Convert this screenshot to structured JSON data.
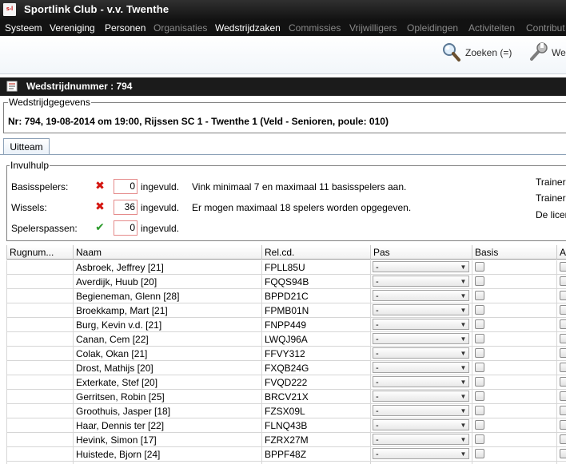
{
  "app": {
    "title": "Sportlink Club - v.v. Twenthe",
    "logo_text": "s-l"
  },
  "menu": [
    {
      "label": "Systeem",
      "enabled": true
    },
    {
      "label": "Vereniging",
      "enabled": true
    },
    {
      "label": "Personen",
      "enabled": true
    },
    {
      "label": "Organisaties",
      "enabled": false
    },
    {
      "label": "Wedstrijdzaken",
      "enabled": true
    },
    {
      "label": "Commissies",
      "enabled": false
    },
    {
      "label": "Vrijwilligers",
      "enabled": false
    },
    {
      "label": "Opleidingen",
      "enabled": false
    },
    {
      "label": "Activiteiten",
      "enabled": false
    },
    {
      "label": "Contribut",
      "enabled": false
    }
  ],
  "toolbar": {
    "search_label": "Zoeken (=)",
    "second_label": "We"
  },
  "document": {
    "title": "Wedstrijdnummer : 794"
  },
  "details": {
    "legend": "Wedstrijdgegevens",
    "match_info": "Nr: 794, 19-08-2014 om 19:00, Rijssen SC 1 - Twenthe 1 (Veld - Senioren, poule: 010)"
  },
  "tabs": [
    {
      "label": "Uitteam"
    }
  ],
  "invulhulp": {
    "legend": "Invulhulp",
    "rows": [
      {
        "label": "Basisspelers:",
        "status": "error",
        "status_icon": "✖",
        "count": "0",
        "suffix": "ingevuld.",
        "message": "Vink minimaal 7 en maximaal 11 basisspelers aan."
      },
      {
        "label": "Wissels:",
        "status": "error",
        "status_icon": "✖",
        "count": "36",
        "suffix": "ingevuld.",
        "message": "Er mogen maximaal 18 spelers worden opgegeven."
      },
      {
        "label": "Spelerspassen:",
        "status": "ok",
        "status_icon": "✔",
        "count": "0",
        "suffix": "ingevuld.",
        "message": ""
      }
    ],
    "right_texts": [
      "Trainer",
      "Trainer",
      "De licer"
    ]
  },
  "table": {
    "columns": [
      "Rugnum...",
      "Naam",
      "Rel.cd.",
      "Pas",
      "Basis",
      "A"
    ],
    "pas_default": "-",
    "rows": [
      {
        "rug": "",
        "naam": "Asbroek, Jeffrey  [21]",
        "rel": "FPLL85U"
      },
      {
        "rug": "",
        "naam": "Averdijk, Huub  [20]",
        "rel": "FQQS94B"
      },
      {
        "rug": "",
        "naam": "Begieneman, Glenn  [28]",
        "rel": "BPPD21C"
      },
      {
        "rug": "",
        "naam": "Broekkamp, Mart  [21]",
        "rel": "FPMB01N"
      },
      {
        "rug": "",
        "naam": "Burg, Kevin v.d.  [21]",
        "rel": "FNPP449"
      },
      {
        "rug": "",
        "naam": "Canan, Cem  [22]",
        "rel": "LWQJ96A"
      },
      {
        "rug": "",
        "naam": "Colak, Okan  [21]",
        "rel": "FFVY312"
      },
      {
        "rug": "",
        "naam": "Drost, Mathijs  [20]",
        "rel": "FXQB24G"
      },
      {
        "rug": "",
        "naam": "Exterkate, Stef  [20]",
        "rel": "FVQD222"
      },
      {
        "rug": "",
        "naam": "Gerritsen, Robin  [25]",
        "rel": "BRCV21X"
      },
      {
        "rug": "",
        "naam": "Groothuis, Jasper  [18]",
        "rel": "FZSX09L"
      },
      {
        "rug": "",
        "naam": "Haar, Dennis ter  [22]",
        "rel": "FLNQ43B"
      },
      {
        "rug": "",
        "naam": "Hevink, Simon  [17]",
        "rel": "FZRX27M"
      },
      {
        "rug": "",
        "naam": "Huistede, Bjorn  [24]",
        "rel": "BPPF48Z"
      },
      {
        "rug": "",
        "naam": "",
        "rel": ""
      }
    ]
  },
  "colors": {
    "titlebar": "#121212",
    "error": "#d4140f",
    "ok": "#2a9a2a"
  }
}
